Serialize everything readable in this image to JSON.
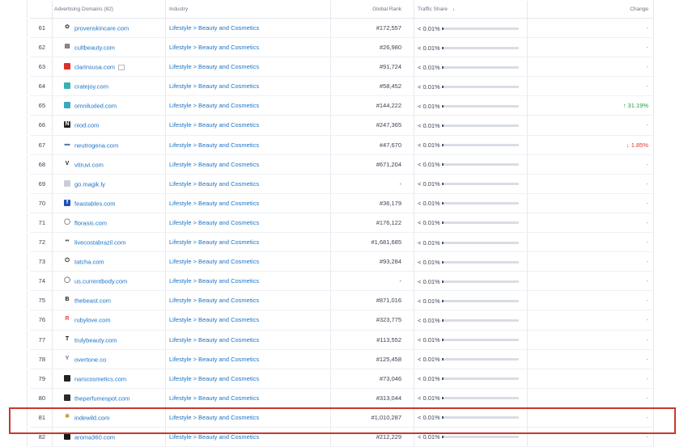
{
  "header": {
    "domains": "Advertising Domains (82)",
    "industry": "Industry",
    "rank": "Global Rank",
    "share": "Traffic Share",
    "sort_icon": "arrow-down-icon",
    "change": "Change"
  },
  "rows": [
    {
      "num": "61",
      "domain": "provenskincare.com",
      "icon": "gear-icon",
      "icon_color": "#555",
      "industry": "Lifestyle > Beauty and Cosmetics",
      "rank": "#172,557",
      "share": "< 0.01%",
      "change": "-",
      "dir": ""
    },
    {
      "num": "62",
      "domain": "cultbeauty.com",
      "icon": "bars-icon",
      "icon_color": "#444",
      "industry": "Lifestyle > Beauty and Cosmetics",
      "rank": "#26,980",
      "share": "< 0.01%",
      "change": "-",
      "dir": ""
    },
    {
      "num": "63",
      "domain": "clarinsusa.com",
      "icon": "red-square-icon",
      "icon_color": "#d9312b",
      "industry": "Lifestyle > Beauty and Cosmetics",
      "rank": "#91,724",
      "share": "< 0.01%",
      "change": "-",
      "dir": ""
    },
    {
      "num": "64",
      "domain": "cratejoy.com",
      "icon": "teal-square-icon",
      "icon_color": "#36b3b0",
      "industry": "Lifestyle > Beauty and Cosmetics",
      "rank": "#58,452",
      "share": "< 0.01%",
      "change": "-",
      "dir": ""
    },
    {
      "num": "65",
      "domain": "omniluxled.com",
      "icon": "teal-square-icon",
      "icon_color": "#3aa7c4",
      "industry": "Lifestyle > Beauty and Cosmetics",
      "rank": "#144,222",
      "share": "< 0.01%",
      "change": "↑ 31.19%",
      "dir": "up"
    },
    {
      "num": "66",
      "domain": "niod.com",
      "icon": "n-logo-icon",
      "icon_color": "#222",
      "industry": "Lifestyle > Beauty and Cosmetics",
      "rank": "#247,365",
      "share": "< 0.01%",
      "change": "-",
      "dir": ""
    },
    {
      "num": "67",
      "domain": "neutrogena.com",
      "icon": "blue-logo-icon",
      "icon_color": "#5a7bb5",
      "industry": "Lifestyle > Beauty and Cosmetics",
      "rank": "#47,670",
      "share": "< 0.01%",
      "change": "↓ 1.85%",
      "dir": "down"
    },
    {
      "num": "68",
      "domain": "vitruvi.com",
      "icon": "v-logo-icon",
      "icon_color": "#222",
      "industry": "Lifestyle > Beauty and Cosmetics",
      "rank": "#671,204",
      "share": "< 0.01%",
      "change": "-",
      "dir": ""
    },
    {
      "num": "69",
      "domain": "go.magik.ly",
      "icon": "page-icon",
      "icon_color": "#c9ced8",
      "industry": "Lifestyle > Beauty and Cosmetics",
      "rank": "-",
      "share": "< 0.01%",
      "change": "-",
      "dir": ""
    },
    {
      "num": "70",
      "domain": "feastables.com",
      "icon": "f-logo-icon",
      "icon_color": "#1d4fb8",
      "industry": "Lifestyle > Beauty and Cosmetics",
      "rank": "#36,179",
      "share": "< 0.01%",
      "change": "-",
      "dir": ""
    },
    {
      "num": "71",
      "domain": "florasis.com",
      "icon": "circle-logo-icon",
      "icon_color": "#666",
      "industry": "Lifestyle > Beauty and Cosmetics",
      "rank": "#176,122",
      "share": "< 0.01%",
      "change": "-",
      "dir": ""
    },
    {
      "num": "72",
      "domain": "livecostabrazil.com",
      "icon": "dots-logo-icon",
      "icon_color": "#444",
      "industry": "Lifestyle > Beauty and Cosmetics",
      "rank": "#1,681,685",
      "share": "< 0.01%",
      "change": "-",
      "dir": ""
    },
    {
      "num": "73",
      "domain": "tatcha.com",
      "icon": "power-logo-icon",
      "icon_color": "#222",
      "industry": "Lifestyle > Beauty and Cosmetics",
      "rank": "#93,284",
      "share": "< 0.01%",
      "change": "-",
      "dir": ""
    },
    {
      "num": "74",
      "domain": "us.currentbody.com",
      "icon": "circle-logo-icon",
      "icon_color": "#555",
      "industry": "Lifestyle > Beauty and Cosmetics",
      "rank": "-",
      "share": "< 0.01%",
      "change": "-",
      "dir": ""
    },
    {
      "num": "75",
      "domain": "thebeast.com",
      "icon": "b-logo-icon",
      "icon_color": "#111",
      "industry": "Lifestyle > Beauty and Cosmetics",
      "rank": "#871,016",
      "share": "< 0.01%",
      "change": "-",
      "dir": ""
    },
    {
      "num": "76",
      "domain": "rubylove.com",
      "icon": "r-logo-icon",
      "icon_color": "#e24a4a",
      "industry": "Lifestyle > Beauty and Cosmetics",
      "rank": "#323,775",
      "share": "< 0.01%",
      "change": "-",
      "dir": ""
    },
    {
      "num": "77",
      "domain": "trulybeauty.com",
      "icon": "t-logo-icon",
      "icon_color": "#111",
      "industry": "Lifestyle > Beauty and Cosmetics",
      "rank": "#113,552",
      "share": "< 0.01%",
      "change": "-",
      "dir": ""
    },
    {
      "num": "78",
      "domain": "overtone.co",
      "icon": "y-logo-icon",
      "icon_color": "#7a5fb0",
      "industry": "Lifestyle > Beauty and Cosmetics",
      "rank": "#125,458",
      "share": "< 0.01%",
      "change": "-",
      "dir": ""
    },
    {
      "num": "79",
      "domain": "narscosmetics.com",
      "icon": "dark-square-icon",
      "icon_color": "#222",
      "industry": "Lifestyle > Beauty and Cosmetics",
      "rank": "#73,046",
      "share": "< 0.01%",
      "change": "-",
      "dir": ""
    },
    {
      "num": "80",
      "domain": "theperfumespot.com",
      "icon": "dark-square-icon",
      "icon_color": "#2a2a2a",
      "industry": "Lifestyle > Beauty and Cosmetics",
      "rank": "#313,044",
      "share": "< 0.01%",
      "change": "-",
      "dir": ""
    },
    {
      "num": "81",
      "domain": "indewild.com",
      "icon": "star-logo-icon",
      "icon_color": "#c99a2e",
      "industry": "Lifestyle > Beauty and Cosmetics",
      "rank": "#1,010,287",
      "share": "< 0.01%",
      "change": "-",
      "dir": ""
    },
    {
      "num": "82",
      "domain": "aroma360.com",
      "icon": "dark-square-icon",
      "icon_color": "#1a1a1a",
      "industry": "Lifestyle > Beauty and Cosmetics",
      "rank": "#212,229",
      "share": "< 0.01%",
      "change": "-",
      "dir": ""
    }
  ],
  "highlight_row": "82",
  "colors": {
    "link": "#1a73c8",
    "up": "#1e9e4a",
    "down": "#e0392b",
    "highlight": "#c8382f"
  }
}
